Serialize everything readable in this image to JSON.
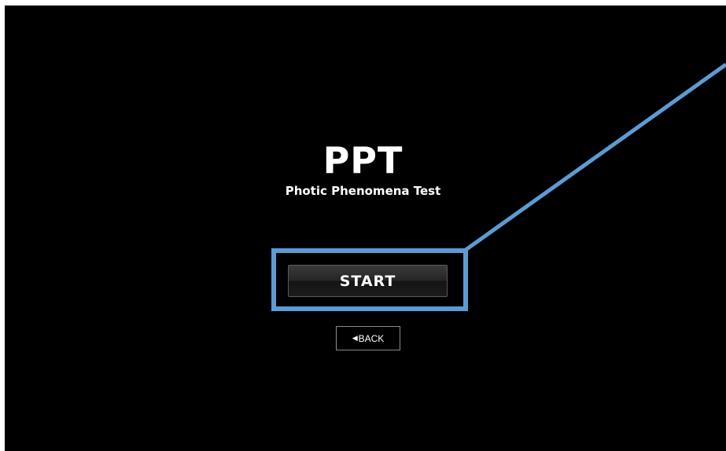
{
  "app": {
    "title": "PPT",
    "subtitle": "Photic Phenomena Test"
  },
  "buttons": {
    "start_label": "START",
    "back_label": "BACK",
    "back_icon": "triangle-left-icon",
    "back_glyph": "◀"
  },
  "colors": {
    "background": "#000000",
    "frame_border": "#ffffff",
    "highlight": "#5c9bd5",
    "text": "#ffffff"
  }
}
